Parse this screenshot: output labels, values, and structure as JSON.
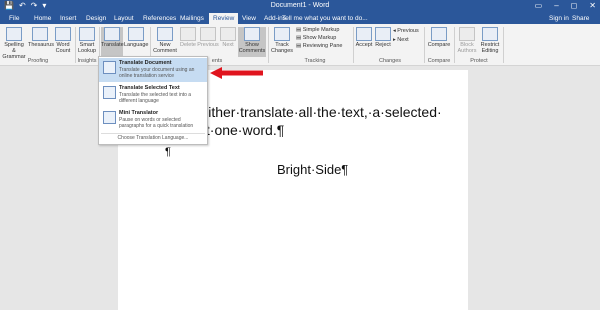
{
  "window": {
    "title": "Document1 - Word",
    "qat": [
      "💾",
      "↶",
      "↷",
      "▾"
    ],
    "controls": [
      "▭",
      "–",
      "◻",
      "✕"
    ]
  },
  "tabs": [
    "File",
    "Home",
    "Insert",
    "Design",
    "Layout",
    "References",
    "Mailings",
    "Review",
    "View",
    "Add-ins"
  ],
  "active_tab": "Review",
  "tell_me": "Tell me what you want to do...",
  "sign_in": "Sign in",
  "share": "Share",
  "ribbon": {
    "proofing": {
      "spelling": "Spelling & Grammar",
      "thesaurus": "Thesaurus",
      "word_count": "Word Count",
      "label": "Proofing"
    },
    "insights": {
      "smart_lookup": "Smart Lookup",
      "label": "Insights"
    },
    "language": {
      "translate": "Translate",
      "language": "Language"
    },
    "comments": {
      "new": "New Comment",
      "delete": "Delete",
      "previous": "Previous",
      "next": "Next",
      "show": "Show Comments",
      "label_tail": "ents"
    },
    "tracking": {
      "track": "Track Changes",
      "simple_markup": "Simple Markup",
      "show_markup": "Show Markup",
      "reviewing_pane": "Reviewing Pane",
      "label": "Tracking"
    },
    "changes": {
      "accept": "Accept",
      "reject": "Reject",
      "previous": "Previous",
      "next": "Next",
      "label": "Changes"
    },
    "compare": {
      "compare": "Compare",
      "label": "Compare"
    },
    "protect": {
      "block": "Block Authors",
      "restrict": "Restrict Editing",
      "label": "Protect"
    }
  },
  "translate_menu": {
    "items": [
      {
        "title": "Translate Document",
        "desc": "Translate your document using an online translation service"
      },
      {
        "title": "Translate Selected Text",
        "desc": "Translate the selected text into a different language"
      },
      {
        "title": "Mini Translator",
        "desc": "Pause on words or selected paragraphs for a quick translation"
      }
    ],
    "footer": "Choose Translation Language..."
  },
  "document": {
    "line1": "n·either·translate·all·the·text,·a·selected·",
    "line2": "just·one·word.¶",
    "pilcrow": "¶",
    "heading": "Bright·Side¶"
  },
  "colors": {
    "accent": "#2b579a",
    "highlight": "#c6dcf2",
    "arrow": "#e0141e"
  }
}
